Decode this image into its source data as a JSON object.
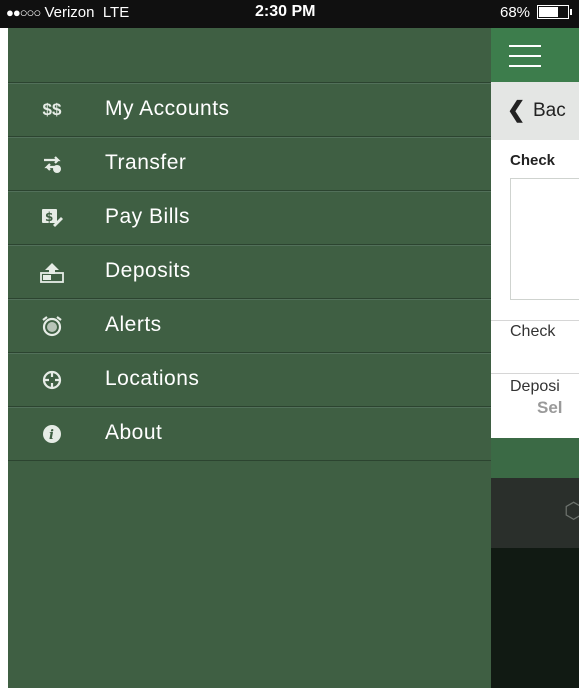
{
  "status_bar": {
    "signal_dots": "●●○○○",
    "carrier": "Verizon",
    "network": "LTE",
    "time": "2:30 PM",
    "battery_percent": "68%",
    "battery_level": 0.68
  },
  "drawer": {
    "items": [
      {
        "label": "My Accounts",
        "icon": "dollar-icon"
      },
      {
        "label": "Transfer",
        "icon": "transfer-icon"
      },
      {
        "label": "Pay Bills",
        "icon": "pay-bills-icon"
      },
      {
        "label": "Deposits",
        "icon": "deposit-icon"
      },
      {
        "label": "Alerts",
        "icon": "alarm-clock-icon"
      },
      {
        "label": "Locations",
        "icon": "crosshair-icon"
      },
      {
        "label": "About",
        "icon": "info-icon"
      }
    ],
    "dollar_glyph": "$$"
  },
  "content": {
    "back_label": "Bac",
    "check_title": "Check",
    "check_label": "Check",
    "deposit_label": "Deposi",
    "select_placeholder": "Sel"
  },
  "colors": {
    "drawer_bg": "#3f5f43",
    "header_green": "#3d7d4c",
    "status_bg": "#101010"
  }
}
